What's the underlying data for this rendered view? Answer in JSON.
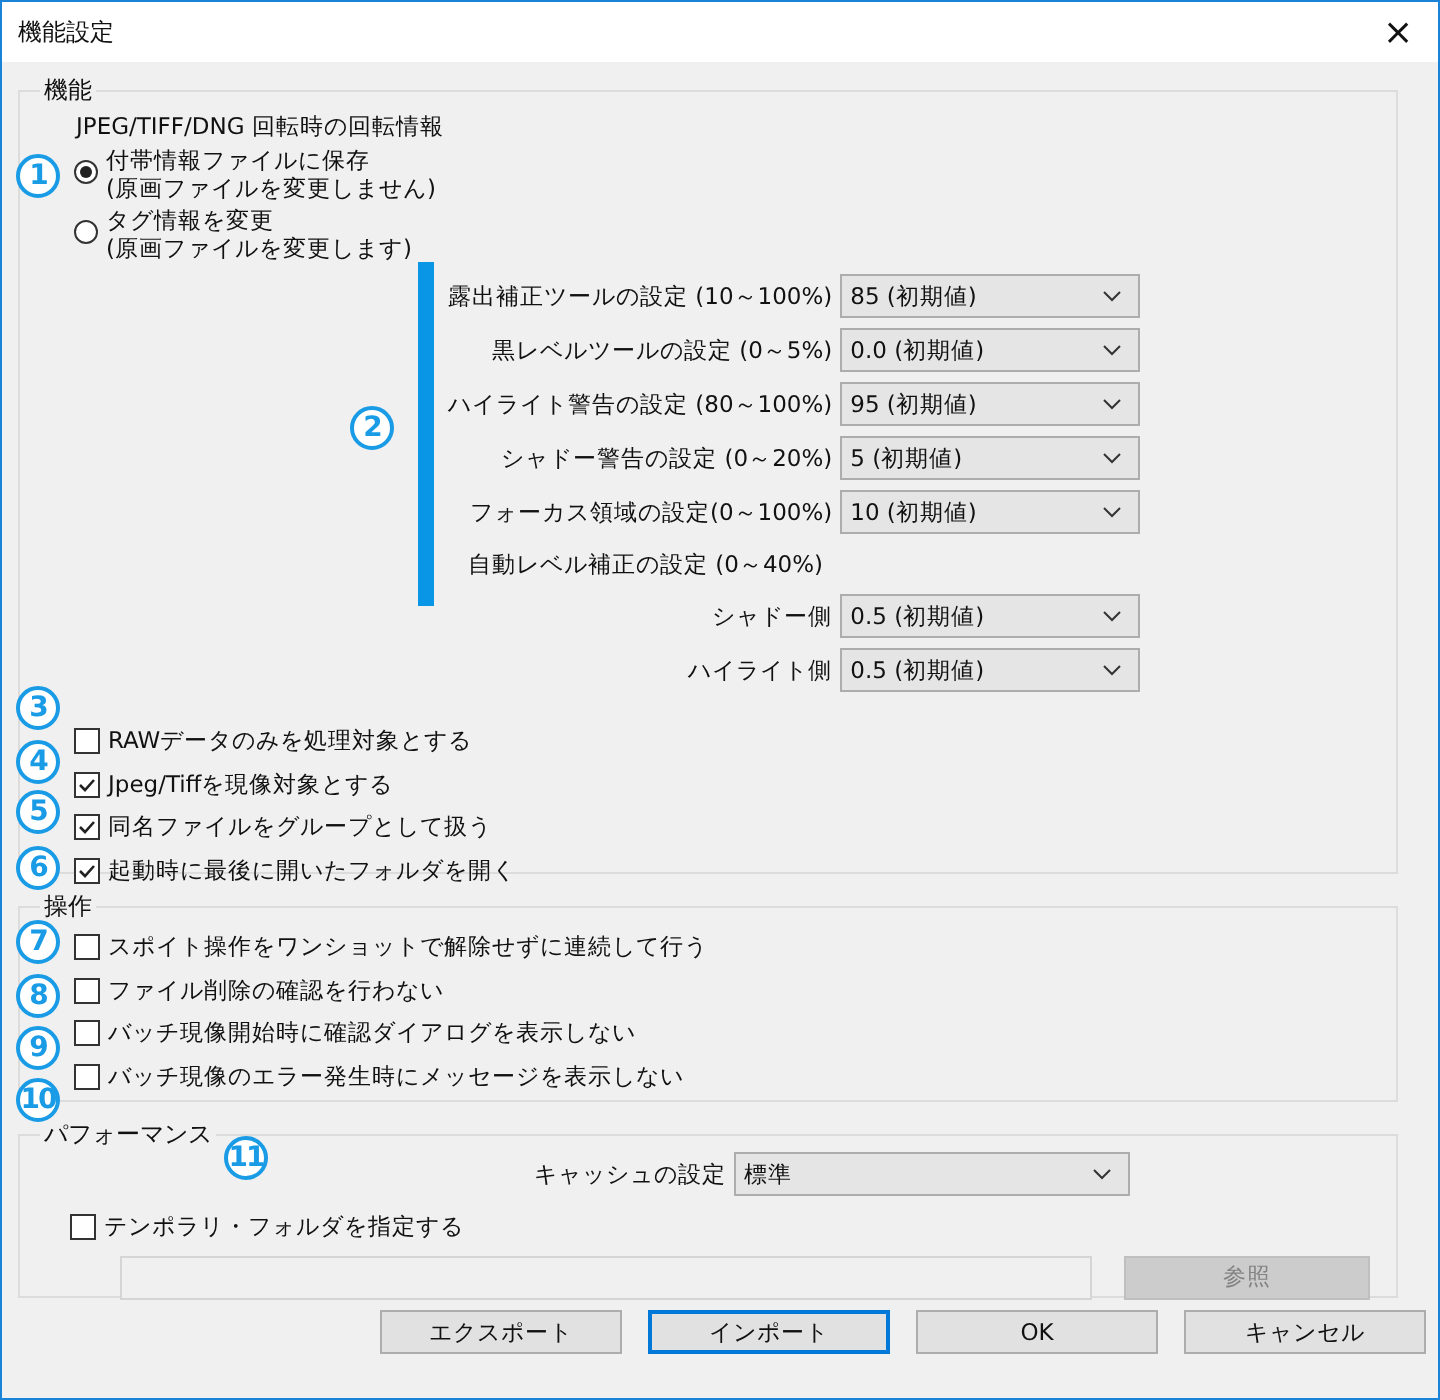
{
  "window": {
    "title": "機能設定",
    "close": "×"
  },
  "features": {
    "title": "機能",
    "rotation": {
      "label": "JPEG/TIFF/DNG 回転時の回転情報",
      "options": [
        {
          "label": "付帯情報ファイルに保存",
          "note": "(原画ファイルを変更しません)",
          "selected": true
        },
        {
          "label": "タグ情報を変更",
          "note": "(原画ファイルを変更します)",
          "selected": false
        }
      ]
    },
    "settings": [
      {
        "label": "露出補正ツールの設定 (10～100%)",
        "value": "85 (初期値)"
      },
      {
        "label": "黒レベルツールの設定 (0～5%)",
        "value": "0.0 (初期値)"
      },
      {
        "label": "ハイライト警告の設定 (80～100%)",
        "value": "95 (初期値)"
      },
      {
        "label": "シャドー警告の設定 (0～20%)",
        "value": "5 (初期値)"
      },
      {
        "label": "フォーカス領域の設定(0～100%)",
        "value": "10 (初期値)"
      }
    ],
    "auto_level": {
      "label": "自動レベル補正の設定 (0～40%)",
      "settings": [
        {
          "label": "シャドー側",
          "value": "0.5 (初期値)"
        },
        {
          "label": "ハイライト側",
          "value": "0.5 (初期値)"
        }
      ]
    },
    "checkboxes": [
      {
        "label": "RAWデータのみを処理対象とする",
        "checked": false
      },
      {
        "label": "Jpeg/Tiffを現像対象とする",
        "checked": true
      },
      {
        "label": "同名ファイルをグループとして扱う",
        "checked": true
      },
      {
        "label": "起動時に最後に開いたフォルダを開く",
        "checked": true
      }
    ]
  },
  "operation": {
    "title": "操作",
    "checkboxes": [
      {
        "label": "スポイト操作をワンショットで解除せずに連続して行う",
        "checked": false
      },
      {
        "label": "ファイル削除の確認を行わない",
        "checked": false
      },
      {
        "label": "バッチ現像開始時に確認ダイアログを表示しない",
        "checked": false
      },
      {
        "label": "バッチ現像のエラー発生時にメッセージを表示しない",
        "checked": false
      }
    ]
  },
  "performance": {
    "title": "パフォーマンス",
    "cache": {
      "label": "キャッシュの設定",
      "value": "標準"
    },
    "temp_folder": {
      "label": "テンポラリ・フォルダを指定する",
      "checked": false
    },
    "browse": {
      "label": "参照",
      "disabled": true
    }
  },
  "buttons": [
    {
      "label": "エクスポート",
      "focused": false
    },
    {
      "label": "インポート",
      "focused": true
    },
    {
      "label": "OK",
      "focused": false
    },
    {
      "label": "キャンセル",
      "focused": false
    }
  ],
  "callouts": [
    {
      "label": "1",
      "bracket": false
    },
    {
      "label": "2",
      "bracket": true
    },
    {
      "label": "3",
      "bracket": false
    },
    {
      "label": "4",
      "bracket": false
    },
    {
      "label": "5",
      "bracket": false
    },
    {
      "label": "6",
      "bracket": false
    },
    {
      "label": "7",
      "bracket": false
    },
    {
      "label": "8",
      "bracket": false
    },
    {
      "label": "9",
      "bracket": false
    },
    {
      "label": "10",
      "bracket": false
    },
    {
      "label": "11",
      "bracket": false
    }
  ]
}
